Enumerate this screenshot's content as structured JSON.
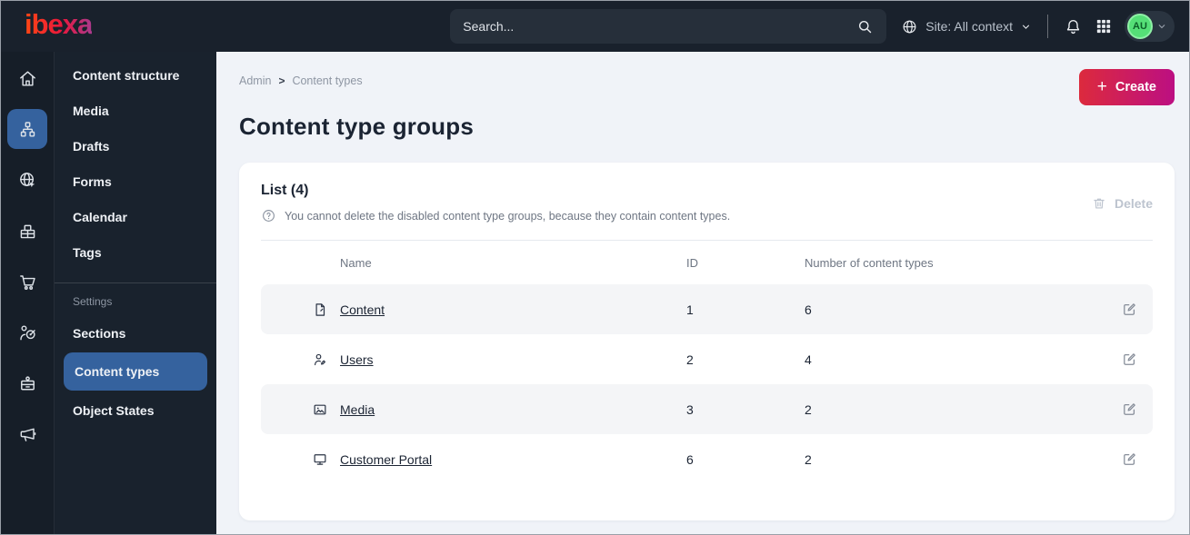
{
  "topbar": {
    "logo_text": "ibexa",
    "search_placeholder": "Search...",
    "site_selector": "Site: All context",
    "avatar_initials": "AU"
  },
  "sidebar": {
    "rail_icons": [
      "home-icon",
      "content-structure-icon",
      "site-globe-icon",
      "products-icon",
      "cart-icon",
      "personalization-icon",
      "admin-badge-icon",
      "marketing-megaphone-icon"
    ],
    "rail_active_index": 1,
    "menu_items": [
      "Content structure",
      "Media",
      "Drafts",
      "Forms",
      "Calendar",
      "Tags"
    ],
    "settings_label": "Settings",
    "settings_items": [
      "Sections",
      "Content types",
      "Object States"
    ],
    "active_item": "Content types"
  },
  "main": {
    "breadcrumb": {
      "items": [
        "Admin",
        "Content types"
      ],
      "separator": ">"
    },
    "create_button": "Create",
    "page_title": "Content type groups",
    "card": {
      "list_title": "List (4)",
      "info_text": "You cannot delete the disabled content type groups, because they contain content types.",
      "delete_button": "Delete",
      "table": {
        "columns": [
          "Name",
          "ID",
          "Number of content types"
        ],
        "rows": [
          {
            "icon": "file-icon",
            "name": "Content",
            "id": "1",
            "content_types": "6"
          },
          {
            "icon": "user-icon",
            "name": "Users",
            "id": "2",
            "content_types": "4"
          },
          {
            "icon": "image-icon",
            "name": "Media",
            "id": "3",
            "content_types": "2"
          },
          {
            "icon": "monitor-icon",
            "name": "Customer Portal",
            "id": "6",
            "content_types": "2"
          }
        ]
      }
    }
  },
  "colors": {
    "topbar-bg": "#19212c",
    "sidebar-bg": "#161e28",
    "accent-blue": "#35629e",
    "create-grad-start": "#dc2a3d",
    "create-grad-end": "#bc0f82",
    "page-bg": "#f0f3f8",
    "row-alt-bg": "#f4f5f7",
    "avatar-green": "#55df77"
  }
}
